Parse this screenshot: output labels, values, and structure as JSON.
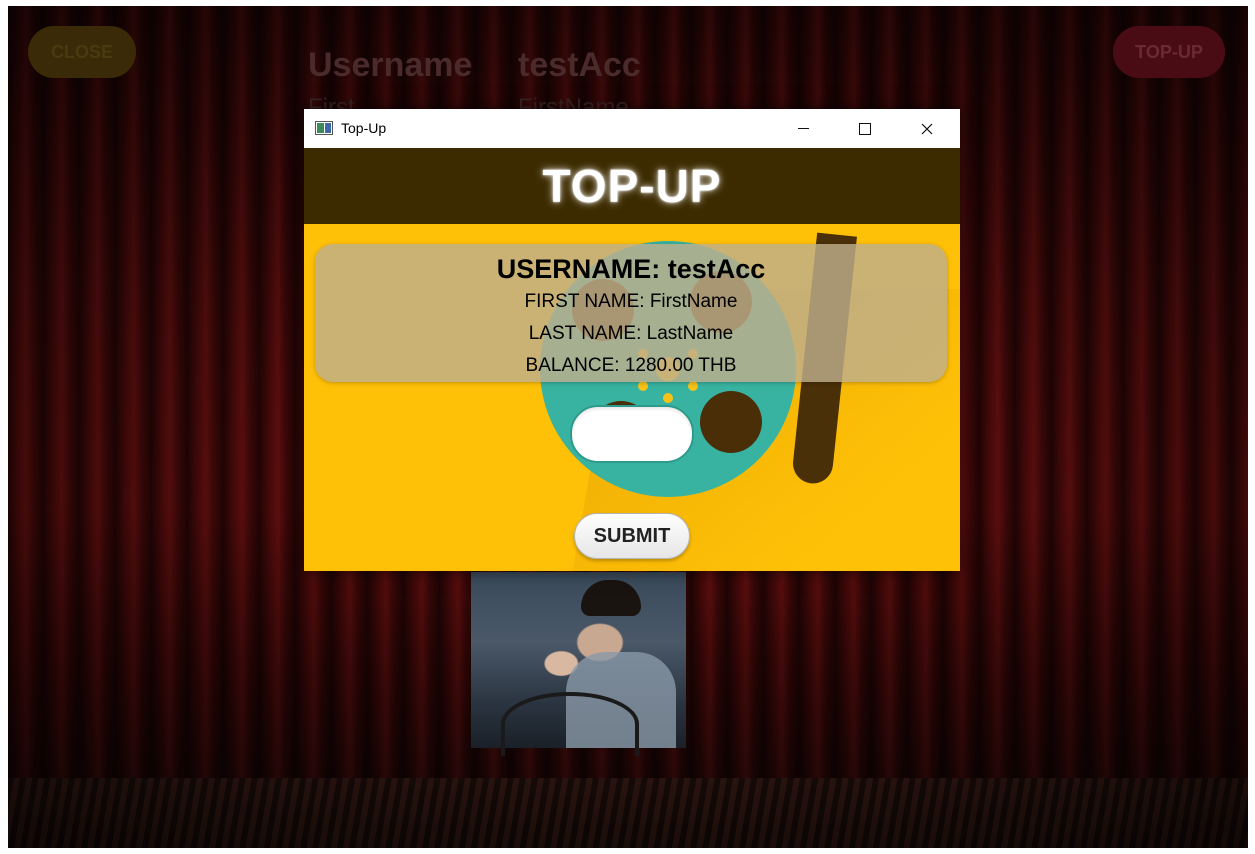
{
  "background_app": {
    "close_label": "CLOSE",
    "topup_label": "TOP-UP",
    "username_label": "Username",
    "username_value": "testAcc",
    "first_label": "First",
    "first_value": "FirstName"
  },
  "window": {
    "title": "Top-Up",
    "controls": {
      "minimize": "—",
      "maximize": "☐",
      "close": "✕"
    }
  },
  "header": {
    "title": "TOP-UP"
  },
  "account": {
    "username_line": "USERNAME: testAcc",
    "first_name_key": "FIRST NAME:",
    "first_name_value": "FirstName",
    "last_name_key": "LAST NAME:",
    "last_name_value": "LastName",
    "balance_key": "BALANCE:",
    "balance_value": "1280.00 THB"
  },
  "form": {
    "amount_value": "",
    "submit_label": "SUBMIT"
  },
  "colors": {
    "modal_bg": "#ffc107",
    "header_band": "#3d2b00",
    "reel": "#39b3a1",
    "input_border": "#2d9a8c"
  },
  "icons": {
    "app": "app-window-icon",
    "reel": "film-reel-icon"
  }
}
